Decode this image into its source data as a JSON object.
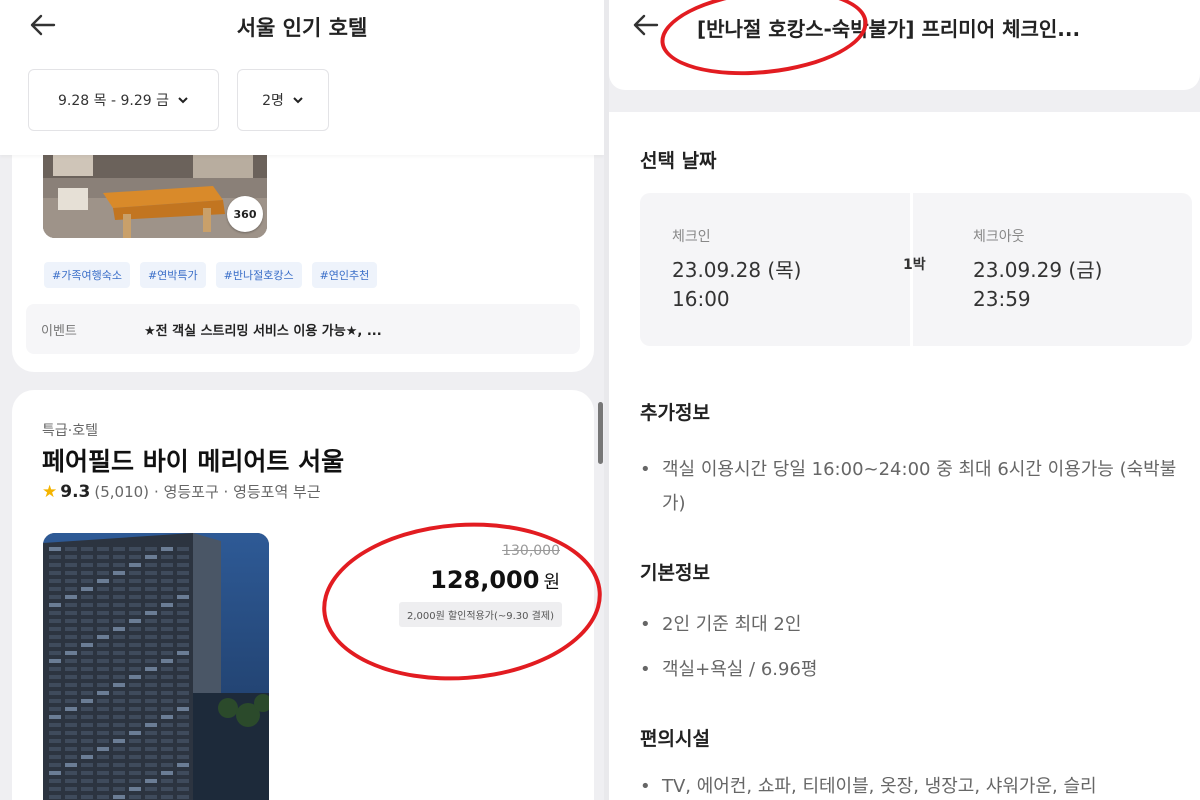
{
  "left": {
    "title": "서울 인기 호텔",
    "date_filter": "9.28 목 - 9.29 금",
    "guest_filter": "2명",
    "card1": {
      "badge": "360",
      "tags": [
        "#가족여행숙소",
        "#연박특가",
        "#반나절호캉스",
        "#연인추천"
      ],
      "event_label": "이벤트",
      "event_text": "★전 객실 스트리밍 서비스 이용 가능★, ..."
    },
    "card2": {
      "grade": "특급·호텔",
      "name": "페어필드 바이 메리어트 서울",
      "rating": "9.3",
      "reviews": "(5,010)",
      "location": "· 영등포구 · 영등포역 부근",
      "original_price": "130,000",
      "price": "128,000",
      "price_unit": "원",
      "coupon": "2,000원 할인적용가(~9.30 결제)"
    }
  },
  "right": {
    "title": "[반나절 호캉스-숙박불가] 프리미어 체크인...",
    "selected_date_title": "선택 날짜",
    "checkin_label": "체크인",
    "checkin_date": "23.09.28 (목)",
    "checkin_time": "16:00",
    "nights": "1박",
    "checkout_label": "체크아웃",
    "checkout_date": "23.09.29 (금)",
    "checkout_time": "23:59",
    "additional_title": "추가정보",
    "additional_items": [
      "객실 이용시간 당일 16:00~24:00 중 최대 6시간 이용가능 (숙박불가)"
    ],
    "basic_title": "기본정보",
    "basic_items": [
      "2인 기준 최대 2인",
      "객실+욕실 / 6.96평"
    ],
    "amenities_title": "편의시설",
    "amenities_items": [
      "TV, 에어컨, 쇼파, 티테이블, 옷장, 냉장고, 샤워가운, 슬리"
    ]
  },
  "colors": {
    "annotation_red": "#e21c21",
    "tag_blue": "#3a6ec8",
    "star_yellow": "#f4b400"
  }
}
